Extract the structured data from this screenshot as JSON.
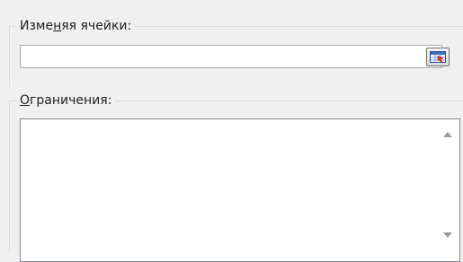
{
  "changing_cells": {
    "label_before": "Изме",
    "label_mnemonic": "н",
    "label_after": "яя ячейки:",
    "value": ""
  },
  "constraints": {
    "label_mnemonic": "О",
    "label_after": "граничения:",
    "items": []
  },
  "icons": {
    "ref_button": "range-select-icon",
    "scroll_up": "scroll-up-arrow-icon",
    "scroll_down": "scroll-down-arrow-icon"
  }
}
